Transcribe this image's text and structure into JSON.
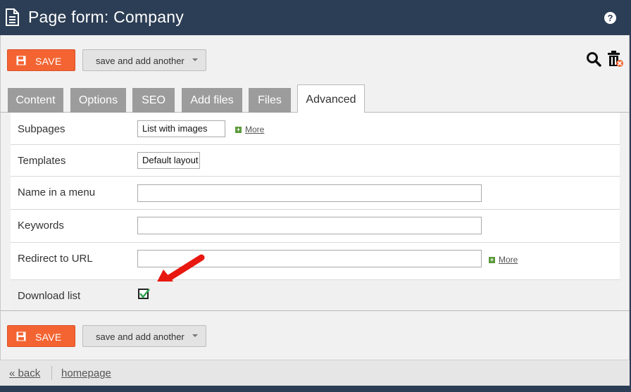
{
  "header": {
    "title": "Page form: Company",
    "help_label": "?"
  },
  "toolbar_top": {
    "save_label": "SAVE",
    "save_and_add_label": "save and add another"
  },
  "toolbar_bottom": {
    "save_label": "SAVE",
    "save_and_add_label": "save and add another"
  },
  "tabs": [
    {
      "label": "Content",
      "active": false
    },
    {
      "label": "Options",
      "active": false
    },
    {
      "label": "SEO",
      "active": false
    },
    {
      "label": "Add files",
      "active": false
    },
    {
      "label": "Files",
      "active": false
    },
    {
      "label": "Advanced",
      "active": true
    }
  ],
  "form": {
    "subpages": {
      "label": "Subpages",
      "value": "List with images",
      "more": "More"
    },
    "templates": {
      "label": "Templates",
      "value": "Default layout"
    },
    "menu_name": {
      "label": "Name in a menu",
      "value": ""
    },
    "keywords": {
      "label": "Keywords",
      "value": ""
    },
    "redirect": {
      "label": "Redirect to URL",
      "value": "",
      "more": "More"
    },
    "download_list": {
      "label": "Download list",
      "checked": true
    }
  },
  "footer": {
    "back_label": "« back",
    "homepage_label": "homepage"
  },
  "colors": {
    "header_bg": "#2c3e55",
    "save_button": "#f36432",
    "tab_inactive": "#9c9c9c",
    "annotation_arrow": "#e8170f",
    "check_mark": "#2ea44f"
  },
  "icons": [
    "document-icon",
    "help-icon",
    "floppy-save-icon",
    "search-icon",
    "trash-icon",
    "plus-icon",
    "check-icon",
    "annotation-arrow"
  ]
}
